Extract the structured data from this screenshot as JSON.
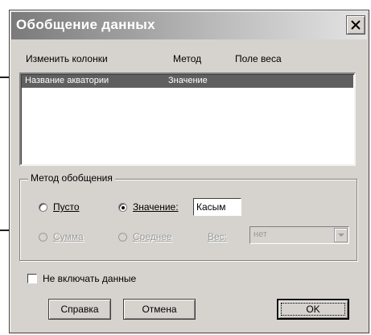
{
  "dialog": {
    "title": "Обобщение данных",
    "close_icon": "close-icon"
  },
  "columns": {
    "header_change": "Изменить колонки",
    "header_method": "Метод",
    "header_weight": "Поле веса"
  },
  "list": {
    "rows": [
      {
        "column": "Название акватории",
        "method": "Значение"
      }
    ]
  },
  "method_group": {
    "legend": "Метод обобщения",
    "empty_label": "Пусто",
    "value_label": "Значение:",
    "value_input": "Касым",
    "sum_label": "Сумма",
    "average_label": "Среднее",
    "weight_label": "Вес:",
    "weight_select": "нет"
  },
  "options": {
    "exclude_data_label": "Не включать данные",
    "exclude_data_checked": false
  },
  "buttons": {
    "help": "Справка",
    "cancel": "Отмена",
    "ok": "OK"
  },
  "colors": {
    "selection": "#5f5f5f",
    "dialog_face": "#d6d3ce"
  }
}
